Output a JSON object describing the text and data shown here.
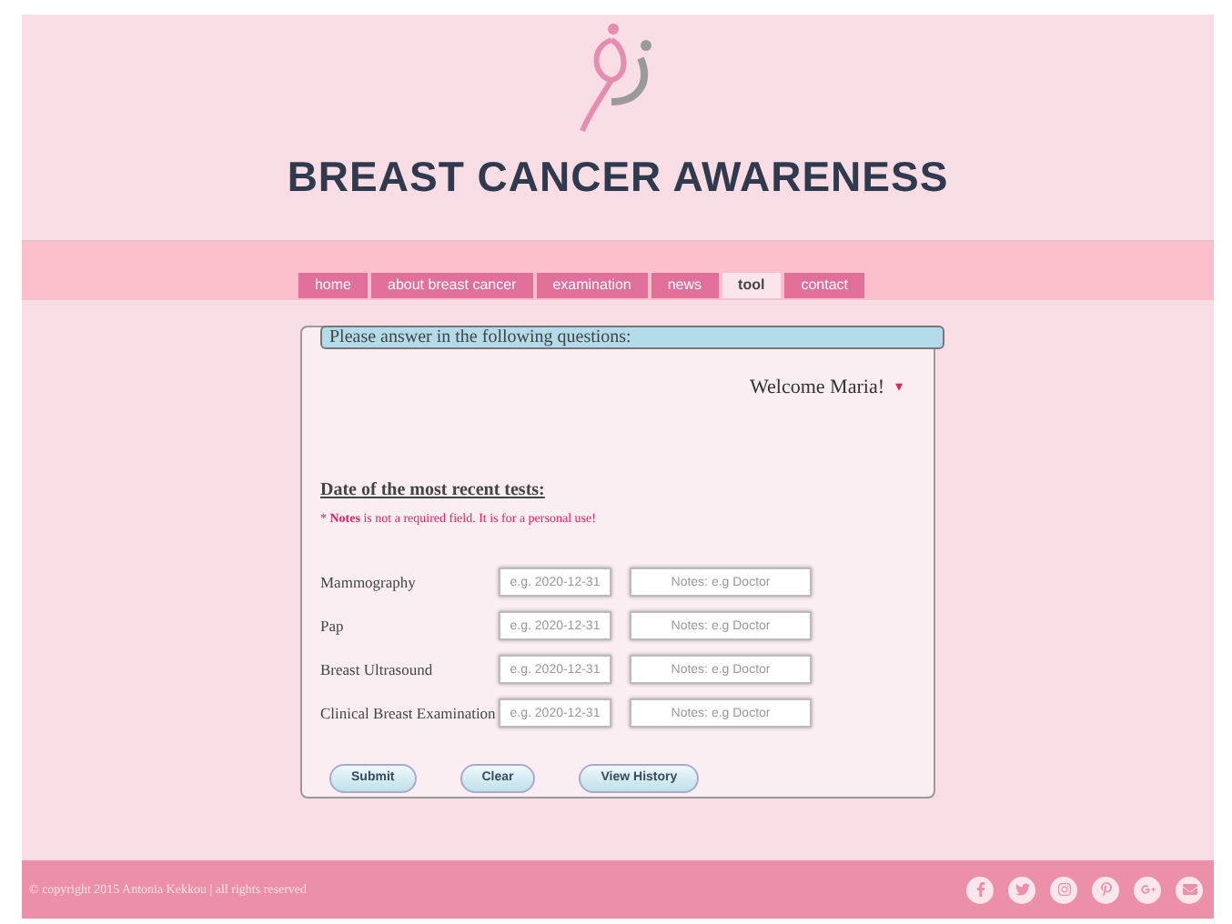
{
  "header": {
    "title": "BREAST CANCER AWARENESS"
  },
  "nav": [
    {
      "label": "home",
      "selected": false
    },
    {
      "label": "about breast cancer",
      "selected": false
    },
    {
      "label": "examination",
      "selected": false
    },
    {
      "label": "news",
      "selected": false
    },
    {
      "label": "tool",
      "selected": true
    },
    {
      "label": "contact",
      "selected": false
    }
  ],
  "form": {
    "legend": "Please answer in the following questions:",
    "welcome": "Welcome Maria!",
    "user_menu_caret": "▾",
    "section_title": "Date of the most recent tests:",
    "note": "* **Notes** is not a required field. It is for a personal use!",
    "rows": [
      {
        "label": "Mammography",
        "date_placeholder": "e.g. 2020-12-31",
        "notes_placeholder": "Notes: e.g Doctor"
      },
      {
        "label": "Pap",
        "date_placeholder": "e.g. 2020-12-31",
        "notes_placeholder": "Notes: e.g Doctor"
      },
      {
        "label": "Breast Ultrasound",
        "date_placeholder": "e.g. 2020-12-31",
        "notes_placeholder": "Notes: e.g Doctor"
      },
      {
        "label": "Clinical Breast Examination",
        "date_placeholder": "e.g. 2020-12-31",
        "notes_placeholder": "Notes: e.g Doctor"
      }
    ],
    "buttons": [
      "Submit",
      "Clear",
      "View History"
    ]
  },
  "footer": {
    "copyright": "© copyright 2015 Antonia Kekkou | all rights reserved",
    "social": [
      {
        "kind": "facebook"
      },
      {
        "kind": "twitter"
      },
      {
        "kind": "instagram"
      },
      {
        "kind": "pinterest"
      },
      {
        "kind": "googleplus"
      },
      {
        "kind": "email"
      }
    ]
  }
}
